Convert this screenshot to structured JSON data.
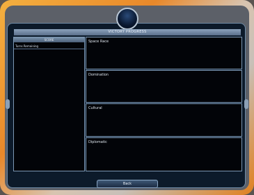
{
  "window": {
    "title": "VICTORY PROGRESS"
  },
  "score_panel": {
    "header": "SCORE",
    "turns_label": "Turns Remaining"
  },
  "victory_types": [
    {
      "label": "Space Race"
    },
    {
      "label": "Domination"
    },
    {
      "label": "Cultural"
    },
    {
      "label": "Diplomatic"
    }
  ],
  "footer": {
    "back_label": "Back"
  },
  "colors": {
    "frame_accent": "#e8882a",
    "panel_border": "#7c98b4",
    "panel_background": "#020408"
  }
}
